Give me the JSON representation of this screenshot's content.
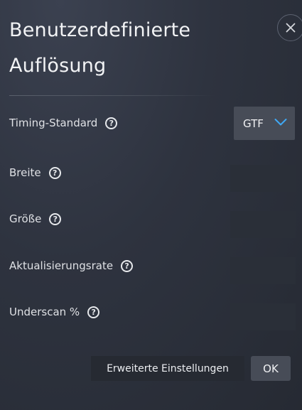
{
  "dialog": {
    "title": "Benutzerdefinierte Auflösung",
    "close_icon": "close-icon"
  },
  "rows": {
    "timing": {
      "label": "Timing-Standard",
      "help_glyph": "?",
      "selected": "GTF"
    },
    "width": {
      "label": "Breite",
      "help_glyph": "?",
      "value": ""
    },
    "size": {
      "label": "Größe",
      "help_glyph": "?",
      "value": ""
    },
    "refresh": {
      "label": "Aktualisierungsrate",
      "help_glyph": "?",
      "value": ""
    },
    "underscan": {
      "label": "Underscan %",
      "help_glyph": "?",
      "value": ""
    }
  },
  "footer": {
    "advanced_label": "Erweiterte Einstellungen",
    "ok_label": "OK"
  },
  "colors": {
    "accent": "#3fa9f5",
    "background": "#2e333f",
    "field": "#2a2f38",
    "button": "#474c57"
  }
}
